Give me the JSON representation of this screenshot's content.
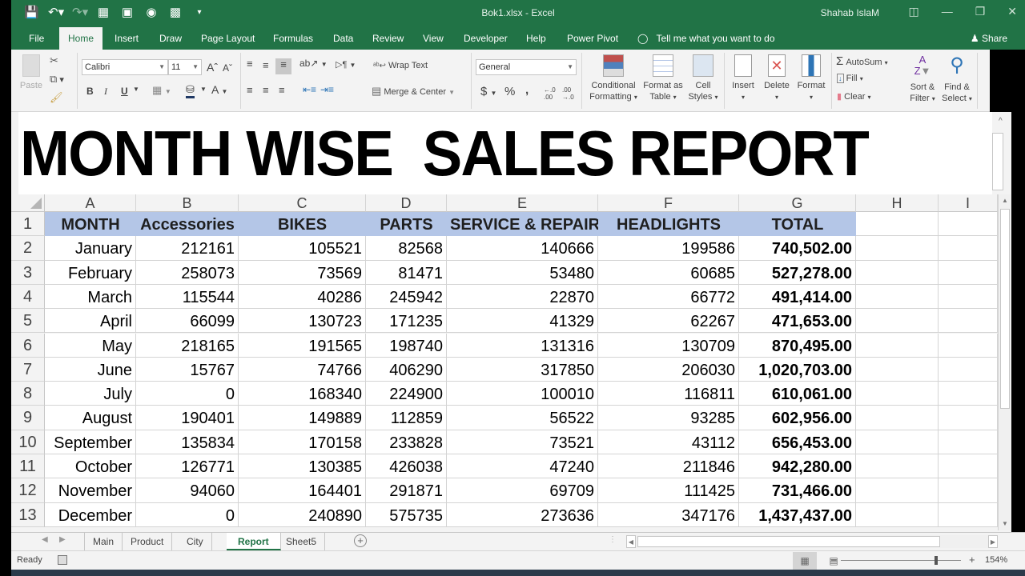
{
  "window": {
    "title": "Bok1.xlsx  -  Excel",
    "user": "Shahab IslaM",
    "controls": [
      "ribbon-display-icon",
      "minimize-icon",
      "restore-icon",
      "close-icon"
    ]
  },
  "quick_access": [
    "save-icon",
    "undo-icon",
    "redo-icon",
    "form-icon",
    "print-preview-icon",
    "camera-icon",
    "calculator-icon",
    "customize-qat-icon"
  ],
  "ribbon_tabs": [
    {
      "label": "File"
    },
    {
      "label": "Home",
      "active": true
    },
    {
      "label": "Insert"
    },
    {
      "label": "Draw"
    },
    {
      "label": "Page Layout"
    },
    {
      "label": "Formulas"
    },
    {
      "label": "Data"
    },
    {
      "label": "Review"
    },
    {
      "label": "View"
    },
    {
      "label": "Developer"
    },
    {
      "label": "Help"
    },
    {
      "label": "Power Pivot"
    }
  ],
  "tell_me": "Tell me what you want to do",
  "share": "Share",
  "ribbon": {
    "paste": "Paste",
    "font_name": "Calibri",
    "font_size": "11",
    "bold": "B",
    "italic": "I",
    "underline": "U",
    "wrap_text": "Wrap Text",
    "merge_center": "Merge & Center",
    "number_format": "General",
    "currency": "$",
    "percent": "%",
    "comma": ",",
    "conditional_formatting": [
      "Conditional",
      "Formatting"
    ],
    "format_as_table": [
      "Format as",
      "Table"
    ],
    "cell_styles": [
      "Cell",
      "Styles"
    ],
    "insert": "Insert",
    "delete": "Delete",
    "format": "Format",
    "autosum": "AutoSum",
    "fill": "Fill",
    "clear": "Clear",
    "sort_filter": [
      "Sort &",
      "Filter"
    ],
    "find_select": [
      "Find &",
      "Select"
    ]
  },
  "banner_title": "MONTH WISE  SALES REPORT",
  "columns": [
    "A",
    "B",
    "C",
    "D",
    "E",
    "F",
    "G",
    "H",
    "I"
  ],
  "table": {
    "headers": [
      "MONTH",
      "Accessories",
      "BIKES",
      "PARTS",
      "SERVICE & REPAIRS",
      "HEADLIGHTS",
      "TOTAL"
    ],
    "rows": [
      {
        "n": "2",
        "month": "January",
        "acc": "212161",
        "bikes": "105521",
        "parts": "82568",
        "service": "140666",
        "head": "199586",
        "total": "740,502.00"
      },
      {
        "n": "3",
        "month": "February",
        "acc": "258073",
        "bikes": "73569",
        "parts": "81471",
        "service": "53480",
        "head": "60685",
        "total": "527,278.00"
      },
      {
        "n": "4",
        "month": "March",
        "acc": "115544",
        "bikes": "40286",
        "parts": "245942",
        "service": "22870",
        "head": "66772",
        "total": "491,414.00"
      },
      {
        "n": "5",
        "month": "April",
        "acc": "66099",
        "bikes": "130723",
        "parts": "171235",
        "service": "41329",
        "head": "62267",
        "total": "471,653.00"
      },
      {
        "n": "6",
        "month": "May",
        "acc": "218165",
        "bikes": "191565",
        "parts": "198740",
        "service": "131316",
        "head": "130709",
        "total": "870,495.00"
      },
      {
        "n": "7",
        "month": "June",
        "acc": "15767",
        "bikes": "74766",
        "parts": "406290",
        "service": "317850",
        "head": "206030",
        "total": "1,020,703.00"
      },
      {
        "n": "8",
        "month": "July",
        "acc": "0",
        "bikes": "168340",
        "parts": "224900",
        "service": "100010",
        "head": "116811",
        "total": "610,061.00"
      },
      {
        "n": "9",
        "month": "August",
        "acc": "190401",
        "bikes": "149889",
        "parts": "112859",
        "service": "56522",
        "head": "93285",
        "total": "602,956.00"
      },
      {
        "n": "10",
        "month": "September",
        "acc": "135834",
        "bikes": "170158",
        "parts": "233828",
        "service": "73521",
        "head": "43112",
        "total": "656,453.00"
      },
      {
        "n": "11",
        "month": "October",
        "acc": "126771",
        "bikes": "130385",
        "parts": "426038",
        "service": "47240",
        "head": "211846",
        "total": "942,280.00"
      },
      {
        "n": "12",
        "month": "November",
        "acc": "94060",
        "bikes": "164401",
        "parts": "291871",
        "service": "69709",
        "head": "111425",
        "total": "731,466.00"
      },
      {
        "n": "13",
        "month": "December",
        "acc": "0",
        "bikes": "240890",
        "parts": "575735",
        "service": "273636",
        "head": "347176",
        "total": "1,437,437.00"
      }
    ]
  },
  "sheet_tabs": [
    {
      "label": "Main"
    },
    {
      "label": "Product"
    },
    {
      "label": "City"
    },
    {
      "label": "Report",
      "active": true
    },
    {
      "label": "Sheet5"
    }
  ],
  "status": {
    "text": "Ready",
    "zoom": "154%"
  },
  "colors": {
    "excel_green": "#217346",
    "header_fill": "#b4c6e7"
  }
}
